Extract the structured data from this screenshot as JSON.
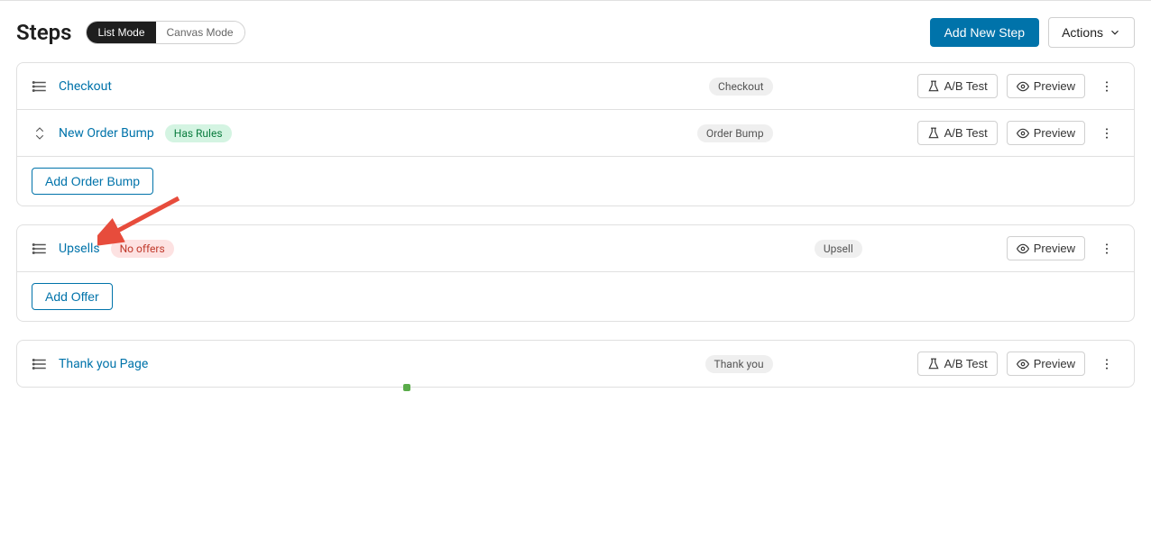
{
  "header": {
    "title": "Steps",
    "mode_list": "List Mode",
    "mode_canvas": "Canvas Mode",
    "add_new_step": "Add New Step",
    "actions": "Actions"
  },
  "buttons": {
    "ab_test": "A/B Test",
    "preview": "Preview",
    "add_order_bump": "Add Order Bump",
    "add_offer": "Add Offer"
  },
  "steps": [
    {
      "name": "Checkout",
      "type": "Checkout",
      "has_ab": true,
      "badge": null
    },
    {
      "name": "New Order Bump",
      "type": "Order Bump",
      "has_ab": true,
      "badge": {
        "text": "Has Rules",
        "style": "green"
      }
    },
    {
      "name": "Upsells",
      "type": "Upsell",
      "has_ab": false,
      "badge": {
        "text": "No offers",
        "style": "red"
      }
    },
    {
      "name": "Thank you Page",
      "type": "Thank you",
      "has_ab": true,
      "badge": null
    }
  ]
}
